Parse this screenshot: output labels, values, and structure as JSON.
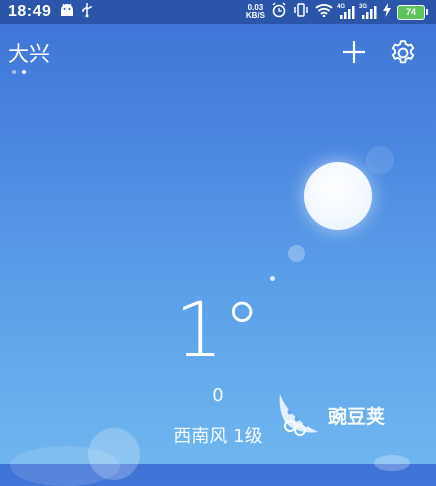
{
  "status_bar": {
    "time": "18:49",
    "net_speed_value": "0.03",
    "net_speed_unit": "KB/S",
    "signal1_tag": "4G",
    "signal2_tag": "3G",
    "battery_level": "74",
    "battery_color": "#5ec25e"
  },
  "header": {
    "city": "大兴",
    "page_dots": 2,
    "active_dot": 1
  },
  "weather": {
    "temperature": "1°",
    "humidity": "0",
    "wind": "西南风 1级"
  },
  "watermark": {
    "text": "豌豆荚"
  }
}
